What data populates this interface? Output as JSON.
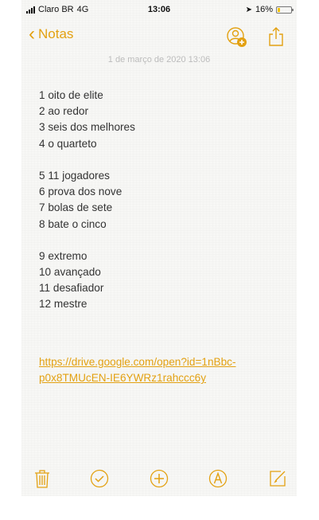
{
  "status": {
    "carrier": "Claro BR",
    "network": "4G",
    "time": "13:06",
    "battery": "16%",
    "battery_level": 0.16
  },
  "nav": {
    "back_label": "Notas"
  },
  "note": {
    "date": "1 de março de 2020 13:06",
    "groups": [
      [
        "1 oito de elite",
        "2 ao redor",
        "3 seis dos melhores",
        "4 o quarteto"
      ],
      [
        "5 11 jogadores",
        "6 prova dos nove",
        "7 bolas de sete",
        "8 bate o cinco"
      ],
      [
        "9 extremo",
        "10 avançado",
        "11 desafiador",
        "12 mestre"
      ]
    ],
    "link": "https://drive.google.com/open?id=1nBbc-p0x8TMUcEN-IE6YWRz1rahccc6y"
  },
  "colors": {
    "accent": "#e3a112",
    "text": "#333333",
    "date": "#bcbcbc"
  },
  "icons": {
    "back": "chevron-left-icon",
    "add_person": "add-person-icon",
    "share": "share-icon",
    "trash": "trash-icon",
    "checklist": "checklist-icon",
    "add": "add-icon",
    "markup": "markup-icon",
    "compose": "compose-icon"
  }
}
